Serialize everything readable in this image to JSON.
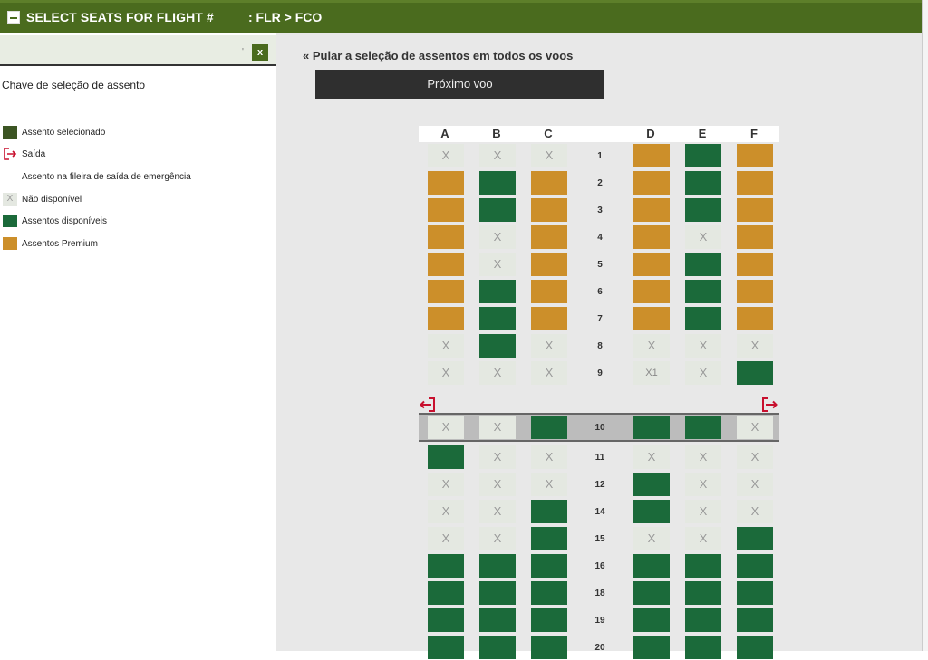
{
  "header": {
    "title": "SELECT SEATS FOR FLIGHT #",
    "route": ": FLR > FCO"
  },
  "sidebar": {
    "filter_tick": "'",
    "close_label": "x",
    "legend_title": "Chave de seleção de assento",
    "legend": [
      {
        "type": "selected",
        "label": "Assento selecionado"
      },
      {
        "type": "exit",
        "label": "Saída"
      },
      {
        "type": "emergency-row",
        "label": "Assento na fileira de saída de emergência"
      },
      {
        "type": "unavailable",
        "label": "Não disponível",
        "glyph": "X"
      },
      {
        "type": "available",
        "label": "Assentos disponíveis"
      },
      {
        "type": "premium",
        "label": "Assentos Premium"
      }
    ]
  },
  "main": {
    "skip_link": "« Pular a seleção de assentos em todos os voos",
    "next_button": "Próximo voo"
  },
  "colors": {
    "header": "#4a6b1e",
    "available": "#1b6a3a",
    "premium": "#cc8f2a",
    "selected": "#3c5523",
    "unavailable": "#e4e8e1",
    "exit_icon": "#c8102e"
  },
  "seatmap": {
    "columns": [
      "A",
      "B",
      "C",
      "D",
      "E",
      "F"
    ],
    "unavailable_glyph": "X",
    "exit_row": "10",
    "rows": [
      {
        "num": "1",
        "seats": [
          "u",
          "u",
          "u",
          "p",
          "a",
          "p"
        ]
      },
      {
        "num": "2",
        "seats": [
          "p",
          "a",
          "p",
          "p",
          "a",
          "p"
        ]
      },
      {
        "num": "3",
        "seats": [
          "p",
          "a",
          "p",
          "p",
          "a",
          "p"
        ]
      },
      {
        "num": "4",
        "seats": [
          "p",
          "u",
          "p",
          "p",
          "u",
          "p"
        ]
      },
      {
        "num": "5",
        "seats": [
          "p",
          "u",
          "p",
          "p",
          "a",
          "p"
        ]
      },
      {
        "num": "6",
        "seats": [
          "p",
          "a",
          "p",
          "p",
          "a",
          "p"
        ]
      },
      {
        "num": "7",
        "seats": [
          "p",
          "a",
          "p",
          "p",
          "a",
          "p"
        ]
      },
      {
        "num": "8",
        "seats": [
          "u",
          "a",
          "u",
          "u",
          "u",
          "u"
        ]
      },
      {
        "num": "9",
        "seats": [
          "u",
          "u",
          "u",
          "X1",
          "u",
          "a"
        ]
      },
      {
        "num": "10",
        "seats": [
          "u",
          "u",
          "a",
          "a",
          "a",
          "u"
        ]
      },
      {
        "num": "11",
        "seats": [
          "a",
          "u",
          "u",
          "u",
          "u",
          "u"
        ]
      },
      {
        "num": "12",
        "seats": [
          "u",
          "u",
          "u",
          "a",
          "u",
          "u"
        ]
      },
      {
        "num": "14",
        "seats": [
          "u",
          "u",
          "a",
          "a",
          "u",
          "u"
        ]
      },
      {
        "num": "15",
        "seats": [
          "u",
          "u",
          "a",
          "u",
          "u",
          "a"
        ]
      },
      {
        "num": "16",
        "seats": [
          "a",
          "a",
          "a",
          "a",
          "a",
          "a"
        ]
      },
      {
        "num": "18",
        "seats": [
          "a",
          "a",
          "a",
          "a",
          "a",
          "a"
        ]
      },
      {
        "num": "19",
        "seats": [
          "a",
          "a",
          "a",
          "a",
          "a",
          "a"
        ]
      },
      {
        "num": "20",
        "seats": [
          "a",
          "a",
          "a",
          "a",
          "a",
          "a"
        ]
      }
    ]
  }
}
